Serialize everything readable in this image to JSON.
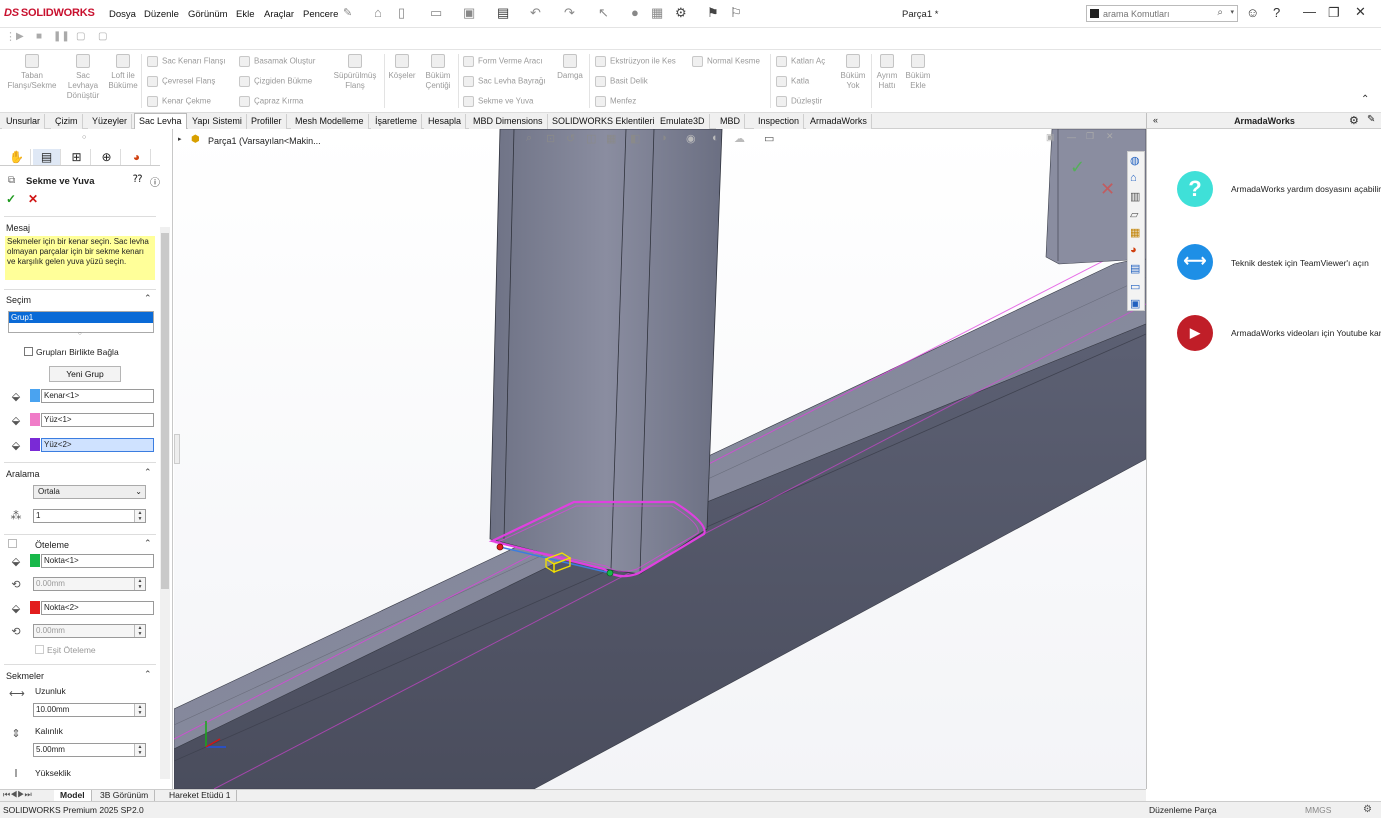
{
  "app": {
    "brand": "SOLIDWORKS",
    "doc_title": "Parça1 *"
  },
  "menu": [
    "Dosya",
    "Düzenle",
    "Görünüm",
    "Ekle",
    "Araçlar",
    "Pencere"
  ],
  "search": {
    "placeholder": "arama Komutları"
  },
  "ribbon": {
    "big": [
      {
        "label": "Taban Flanşı/Sekme"
      },
      {
        "label": "Sac Levhaya Dönüştür"
      },
      {
        "label": "Loft ile Büküme"
      },
      {
        "label": "Süpürülmüş Flanş"
      },
      {
        "label": "Köşeler"
      },
      {
        "label": "Büküm Çentiği"
      },
      {
        "label": "Damga"
      },
      {
        "label": "Büküm Yok"
      },
      {
        "label": "Ayrım Hattı"
      },
      {
        "label": "Büküm Ekle"
      }
    ],
    "small": [
      "Sac Kenarı Flanşı",
      "Çevresel Flanş",
      "Kenar Çekme",
      "Basamak Oluştur",
      "Çizgiden Bükme",
      "Çapraz Kırma",
      "Form Verme Aracı",
      "Sac Levha Bayrağı",
      "Sekme ve Yuva",
      "Ekstrüzyon ile Kes",
      "Basit Delik",
      "Menfez",
      "Normal Kesme",
      "Katları Aç",
      "Katla",
      "Düzleştir"
    ]
  },
  "tabs": [
    "Unsurlar",
    "Çizim",
    "Yüzeyler",
    "Sac Levha",
    "Yapı Sistemi",
    "Profiller",
    "Mesh Modelleme",
    "İşaretleme",
    "Hesapla",
    "MBD Dimensions",
    "SOLIDWORKS Eklentileri",
    "Emulate3D",
    "MBD",
    "Inspection",
    "ArmadaWorks"
  ],
  "active_tab": "Sac Levha",
  "pm": {
    "title": "Sekme ve Yuva",
    "mesaj_header": "Mesaj",
    "message": "Sekmeler için bir kenar seçin. Sac levha olmayan parçalar için bir sekme kenarı ve karşılık gelen yuva yüzü seçin.",
    "secim_header": "Seçim",
    "group_item": "Grup1",
    "group_together_label": "Grupları Birlikte Bağla",
    "new_group_button": "Yeni Grup",
    "edge_field": "Kenar<1>",
    "face1_field": "Yüz<1>",
    "face2_field": "Yüz<2>",
    "aralama_header": "Aralama",
    "spacing_mode": "Ortala",
    "count": "1",
    "oteleme_header": "Öteleme",
    "point1": "Nokta<1>",
    "offset1": "0.00mm",
    "point2": "Nokta<2>",
    "offset2": "0.00mm",
    "equal_offset_label": "Eşit Öteleme",
    "sekmeler_header": "Sekmeler",
    "length_label": "Uzunluk",
    "length": "10.00mm",
    "thickness_label": "Kalınlık",
    "thickness": "5.00mm",
    "height_label": "Yükseklik"
  },
  "tree": {
    "label": "Parça1 (Varsayılan<Makin..."
  },
  "armada": {
    "title": "ArmadaWorks",
    "items": [
      {
        "icon": "?",
        "text": "ArmadaWorks yardım dosyasını açabilirs",
        "color": "#3fe0d8"
      },
      {
        "icon": "⟷",
        "text": "Teknik destek için TeamViewer'ı açın",
        "color": "#1e8fe6"
      },
      {
        "icon": "▶",
        "text": "ArmadaWorks videoları için Youtube kan",
        "color": "#c01e28"
      }
    ]
  },
  "bottom_tabs": [
    "Model",
    "3B Görünüm",
    "Hareket Etüdü 1"
  ],
  "status": {
    "left": "SOLIDWORKS Premium 2025 SP2.0",
    "mode": "Düzenleme Parça",
    "units": "MMGS"
  },
  "colors": {
    "selection_blue": "#0a6ad6",
    "edge_swatch": "#4aa3f0",
    "face1_swatch": "#f07cc8",
    "face2_swatch": "#7a2ad6",
    "point1_swatch": "#18b84a",
    "point2_swatch": "#e21d1d",
    "message_bg": "#ffff99",
    "model_highlight": "#e040e0"
  }
}
